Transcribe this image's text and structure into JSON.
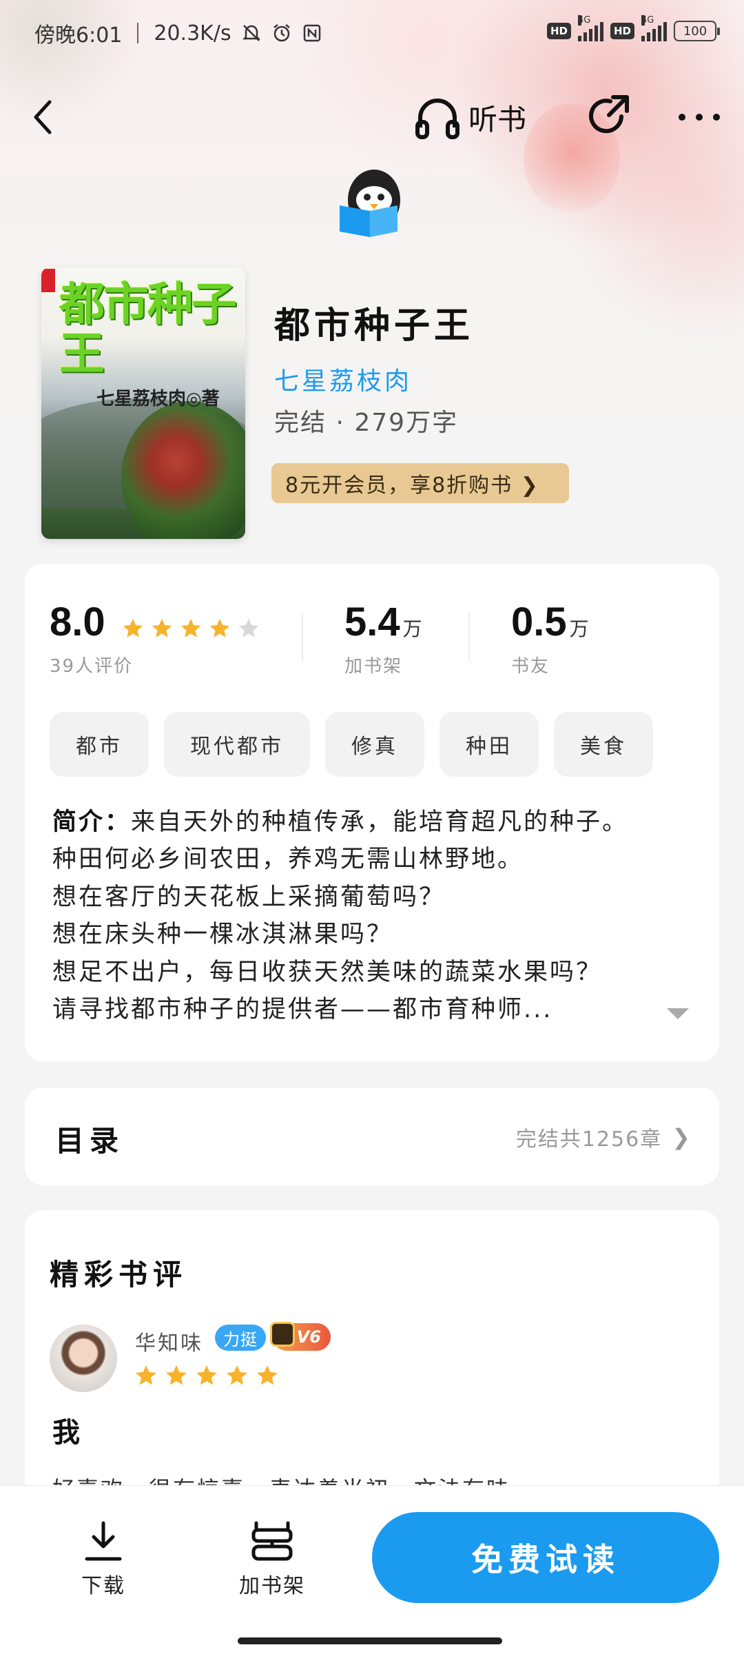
{
  "status_bar": {
    "time": "傍晚6:01",
    "speed": "20.3K/s",
    "network": "4G",
    "network2": "4G",
    "hd": "HD",
    "hd2": "HD",
    "battery": "100"
  },
  "nav": {
    "listen_label": "听书"
  },
  "book": {
    "cover_title": "都市种子王",
    "cover_author": "七星荔枝肉◎著",
    "title": "都市种子王",
    "author": "七星荔枝肉",
    "status": "完结",
    "word_count": "279万字",
    "vip_promo": "8元开会员，享8折购书 ❯"
  },
  "stats": {
    "rating": "8.0",
    "rating_stars": 4,
    "rating_count": "39人评价",
    "shelf_value": "5.4",
    "shelf_unit": "万",
    "shelf_label": "加书架",
    "friends_value": "0.5",
    "friends_unit": "万",
    "friends_label": "书友"
  },
  "tags": [
    "都市",
    "现代都市",
    "修真",
    "种田",
    "美食"
  ],
  "intro": {
    "label": "简介：",
    "lines": [
      "来自天外的种植传承，能培育超凡的种子。",
      "种田何必乡间农田，养鸡无需山林野地。",
      "想在客厅的天花板上采摘葡萄吗？",
      "想在床头种一棵冰淇淋果吗？",
      "想足不出户，每日收获天然美味的蔬菜水果吗？",
      "请寻找都市种子的提供者——都市育种师..."
    ]
  },
  "toc": {
    "title": "目录",
    "info": "完结共1256章"
  },
  "reviews": {
    "title": "精彩书评",
    "items": [
      {
        "name": "华知味",
        "badge": "力挺",
        "level": "V6",
        "stars": 5,
        "heading": "我",
        "body": "好喜欢，很有惊喜，表达着当初，文法有味"
      }
    ]
  },
  "bottom": {
    "download_label": "下载",
    "shelf_label": "加书架",
    "read_label": "免费试读"
  },
  "colors": {
    "accent": "#1a9bf0",
    "star": "#f7b32b",
    "vip_bg": "#e8c993"
  }
}
